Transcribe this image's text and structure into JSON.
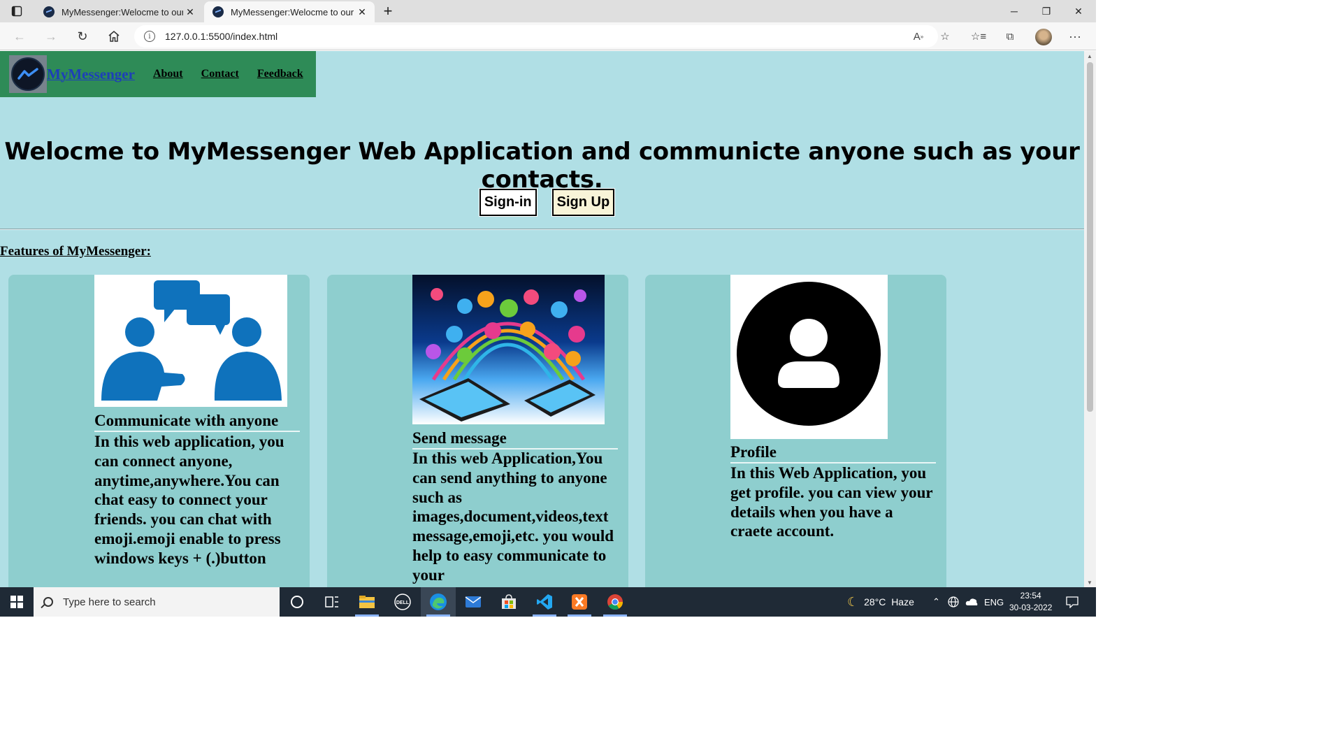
{
  "browser": {
    "tabs": [
      {
        "title": "MyMessenger:Welocme to our w",
        "close": "✕"
      },
      {
        "title": "MyMessenger:Welocme to our w",
        "close": "✕"
      }
    ],
    "new_tab": "+",
    "window": {
      "minimize": "─",
      "restore": "❐",
      "close": "✕"
    },
    "url": "127.0.0.1:5500/index.html",
    "icons": [
      "tab-actions-icon",
      "back-icon",
      "forward-icon",
      "refresh-icon",
      "home-icon",
      "site-info-icon",
      "read-aloud-icon",
      "add-favorite-icon",
      "favorites-icon",
      "collections-icon",
      "profile-avatar",
      "more-icon"
    ]
  },
  "page": {
    "nav": {
      "brand": "MyMessenger",
      "links": [
        "About",
        "Contact",
        "Feedback"
      ]
    },
    "headline": "Welocme to MyMessenger Web Application and communicte anyone such as your contacts.",
    "buttons": {
      "signin": "Sign-in",
      "signup": "Sign Up"
    },
    "features_heading": "Features of MyMessenger:",
    "cards": [
      {
        "title": "Communicate with anyone",
        "text": "In this web application, you can connect anyone, anytime,anywhere.You can chat easy to connect your friends. you can chat with emoji.emoji enable to press windows keys + (.)button",
        "image": "two-people-chatting-image"
      },
      {
        "title": "Send message",
        "text": "In this web Application,You can send anything to anyone such as images,document,videos,text message,emoji,etc. you would help to easy communicate to your",
        "image": "social-media-devices-image"
      },
      {
        "title": "Profile",
        "text": "In this Web Application, you get profile. you can view your details when you have a craete account.",
        "image": "profile-user-icon"
      }
    ],
    "colors": {
      "page_bg": "#b0dfe5",
      "nav_bg": "#2e8b57",
      "brand": "#1d3fb8",
      "card_bg": "#8ecece",
      "icon_blue": "#0f72bc"
    }
  },
  "taskbar": {
    "search_placeholder": "Type here to search",
    "weather": "28°C  Haze",
    "language": "ENG",
    "time": "23:54",
    "date": "30-03-2022",
    "apps": [
      "start-icon",
      "cortana-icon",
      "task-view-icon",
      "file-explorer-icon",
      "dell-icon",
      "edge-icon",
      "mail-icon",
      "store-icon",
      "vscode-icon",
      "xampp-icon",
      "chrome-icon"
    ]
  }
}
